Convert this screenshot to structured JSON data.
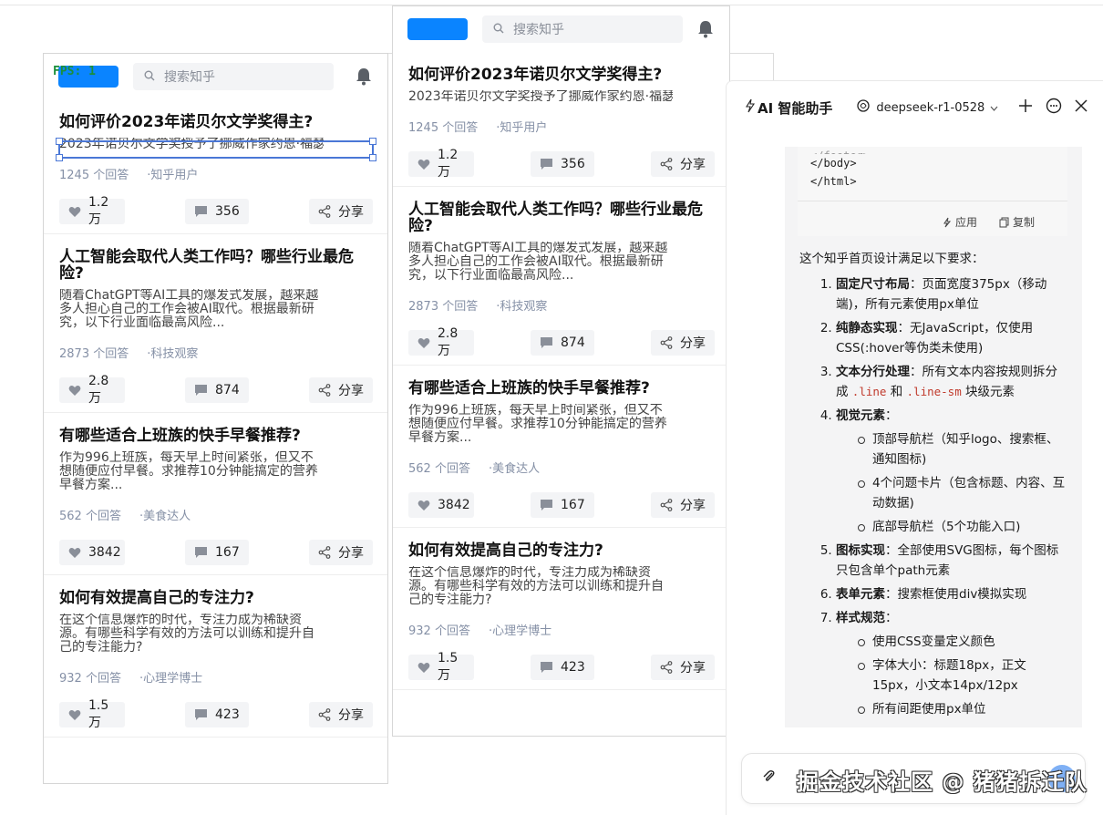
{
  "fps_label": "FPS: 1",
  "search_placeholder": "搜索知乎",
  "posts": [
    {
      "title": "如何评价2023年诺贝尔文学奖得主?",
      "excerpt": "2023年诺贝尔文学奖授予了挪威作家约恩·福瑟，他的作",
      "answers": "1245 个回答",
      "author": "·知乎用户",
      "likes": "1.2万",
      "comments": "356",
      "share": "分享"
    },
    {
      "title": "人工智能会取代人类工作吗？哪些行业最危险?",
      "excerpt": "随着ChatGPT等AI工具的爆发式发展，越来越多人担心自己的工作会被AI取代。根据最新研究，以下行业面临最高风险...",
      "answers": "2873 个回答",
      "author": "·科技观察",
      "likes": "2.8万",
      "comments": "874",
      "share": "分享"
    },
    {
      "title": "有哪些适合上班族的快手早餐推荐?",
      "excerpt": "作为996上班族，每天早上时间紧张，但又不想随便应付早餐。求推荐10分钟能搞定的营养早餐方案...",
      "answers": "562 个回答",
      "author": "·美食达人",
      "likes": "3842",
      "comments": "167",
      "share": "分享"
    },
    {
      "title": "如何有效提高自己的专注力?",
      "excerpt": "在这个信息爆炸的时代，专注力成为稀缺资源。有哪些科学有效的方法可以训练和提升自己的专注能力?",
      "answers": "932 个回答",
      "author": "·心理学博士",
      "likes": "1.5万",
      "comments": "423",
      "share": "分享"
    }
  ],
  "ai": {
    "title": "AI 智能助手",
    "model": "deepseek-r1-0528",
    "code_lines": [
      "</body>",
      "</html>"
    ],
    "apply_label": "应用",
    "copy_label": "复制",
    "summary": "这个知乎首页设计满足以下要求：",
    "items": [
      {
        "bold": "固定尺寸布局",
        "text": "：页面宽度375px（移动端)，所有元素使用px单位"
      },
      {
        "bold": "纯静态实现",
        "text": "：无JavaScript，仅使用CSS(:hover等伪类未使用)"
      },
      {
        "bold": "文本分行处理",
        "text_pre": "：所有文本内容按规则拆分成 ",
        "code1": ".line",
        "mid": " 和 ",
        "code2": ".line-sm",
        "text_post": " 块级元素"
      },
      {
        "bold": "视觉元素",
        "text": "：",
        "sub": [
          "顶部导航栏（知乎logo、搜索框、通知图标)",
          "4个问题卡片（包含标题、内容、互动数据)",
          "底部导航栏（5个功能入口)"
        ]
      },
      {
        "bold": "图标实现",
        "text": "：全部使用SVG图标，每个图标只包含单个path元素"
      },
      {
        "bold": "表单元素",
        "text": "：搜索框使用div模拟实现"
      },
      {
        "bold": "样式规范",
        "text": "：",
        "sub": [
          "使用CSS变量定义颜色",
          "字体大小：标题18px，正文15px，小文本14px/12px",
          "所有间距使用px单位"
        ]
      }
    ]
  },
  "watermark": "掘金技术社区 @ 猪猪拆迁队",
  "colors": {
    "brand": "#0a84ff",
    "meta": "#8590a6",
    "selection": "#4a77d6"
  }
}
